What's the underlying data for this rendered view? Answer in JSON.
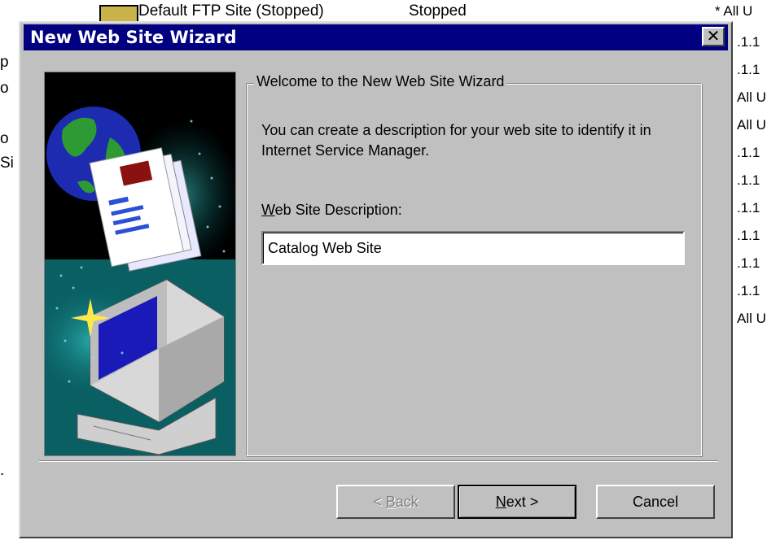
{
  "background": {
    "top_row_name": "Default FTP Site (Stopped)",
    "top_row_state": "Stopped",
    "top_row_ip": "* All U",
    "left_fragments": [
      "p",
      "o",
      "o",
      "Si",
      "."
    ],
    "right_fragments": [
      ".1.1",
      ".1.1",
      "All U",
      "All U",
      ".1.1",
      ".1.1",
      ".1.1",
      ".1.1",
      ".1.1",
      ".1.1",
      "All U"
    ]
  },
  "dialog": {
    "title": "New Web Site Wizard",
    "close_glyph": "✕",
    "group_title": "Welcome to the New Web Site Wizard",
    "description": "You can create a description for your web site to identify it in Internet Service Manager.",
    "field_label": {
      "mnemonic": "W",
      "rest": "eb Site Description:"
    },
    "field_value": "Catalog Web Site"
  },
  "buttons": {
    "back": {
      "prefix": "< ",
      "mnemonic": "B",
      "rest": "ack"
    },
    "next": {
      "mnemonic": "N",
      "rest": "ext >"
    },
    "cancel": "Cancel"
  },
  "colors": {
    "titlebar": "#000080",
    "face": "#c0c0c0",
    "art_teal": "#0a6b6b"
  }
}
